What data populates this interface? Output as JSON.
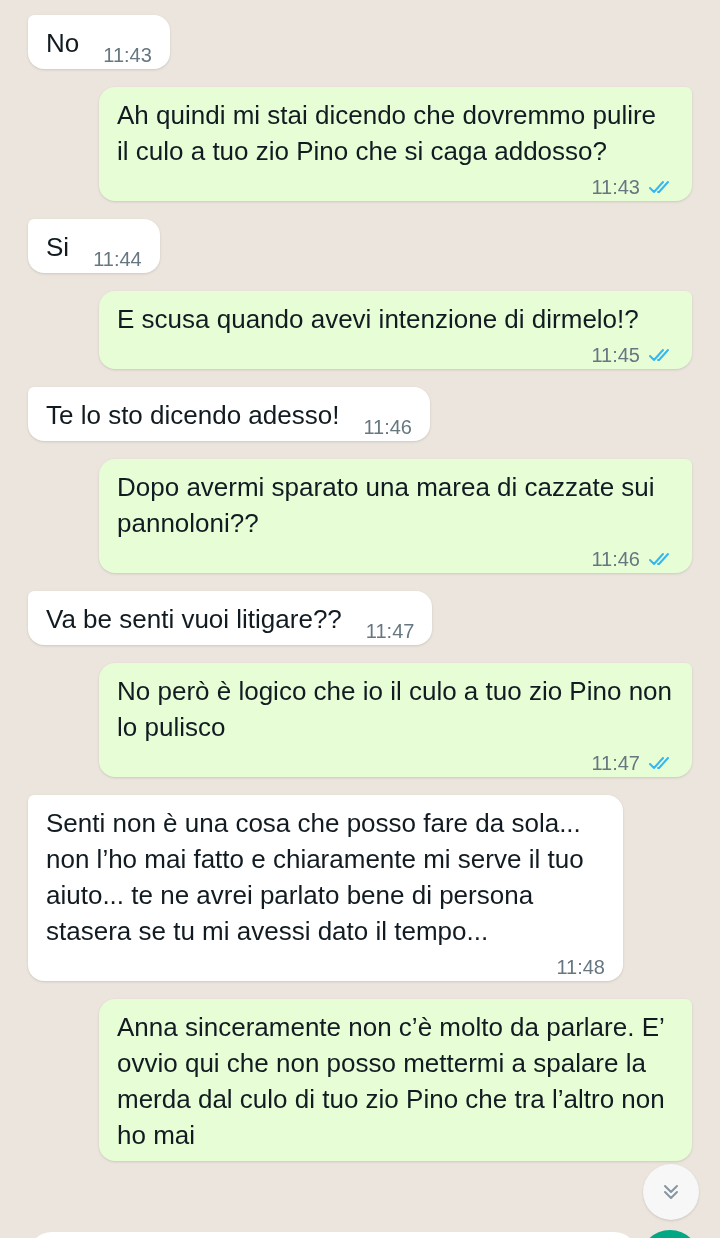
{
  "messages": [
    {
      "kind": "in",
      "text": "No",
      "time": "11:43"
    },
    {
      "kind": "out",
      "text": "Ah quindi mi stai dicendo che dovremmo pulire il culo a tuo zio Pino che si caga addosso?",
      "time": "11:43",
      "read": true
    },
    {
      "kind": "in",
      "text": "Si",
      "time": "11:44"
    },
    {
      "kind": "out",
      "text": "E scusa quando avevi intenzione di dirmelo!?",
      "time": "11:45",
      "read": true
    },
    {
      "kind": "in",
      "text": "Te lo sto dicendo adesso!",
      "time": "11:46"
    },
    {
      "kind": "out",
      "text": "Dopo avermi sparato una marea di cazzate sui pannoloni??",
      "time": "11:46",
      "read": true
    },
    {
      "kind": "in",
      "text": "Va be senti vuoi litigare??",
      "time": "11:47"
    },
    {
      "kind": "out",
      "text": "No però è logico che io il culo a tuo zio Pino non lo pulisco",
      "time": "11:47",
      "read": true
    },
    {
      "kind": "in",
      "text": "Senti non è una cosa che posso fare da sola... non l’ho mai fatto e chiaramente mi serve il tuo aiuto... te ne avrei parlato bene di persona stasera se tu mi avessi dato il tempo...",
      "time": "11:48"
    },
    {
      "kind": "out",
      "text": "Anna sinceramente non c’è molto da parlare. E’ ovvio qui che non posso mettermi a spalare la merda dal culo di tuo zio Pino che tra l’altro non ho mai"
    }
  ]
}
